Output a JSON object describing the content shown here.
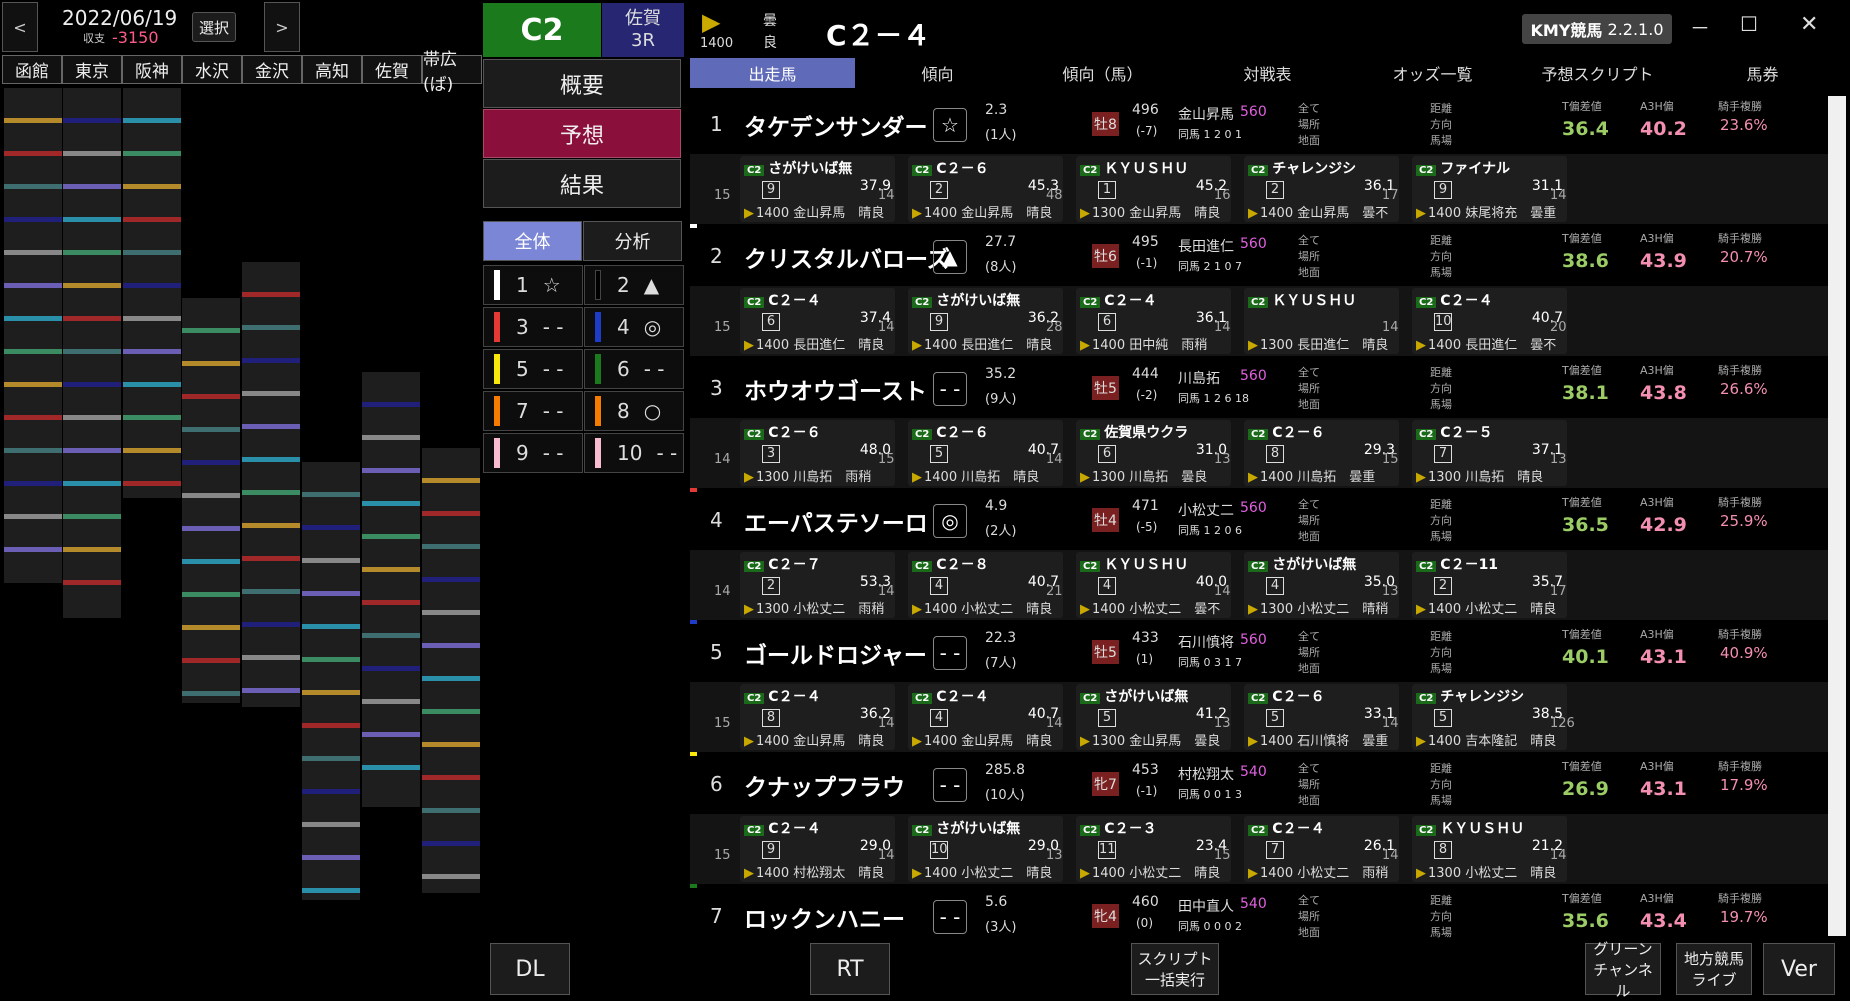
{
  "header": {
    "prev": "<",
    "next": ">",
    "date": "2022/06/19",
    "balance_label": "収支",
    "balance": "-3150",
    "select": "選択"
  },
  "venues": [
    "函館",
    "東京",
    "阪神",
    "水沢",
    "金沢",
    "高知",
    "佐賀",
    "帯広(ば)"
  ],
  "class_badge": "C2",
  "track": "佐賀",
  "race_no": "3R",
  "menu": {
    "overview": "概要",
    "predict": "予想",
    "result": "結果",
    "all": "全体",
    "analysis": "分析"
  },
  "marks": [
    {
      "no": "1",
      "mark": "☆",
      "color": "#ffffff"
    },
    {
      "no": "2",
      "mark": "▲",
      "color": "#000000"
    },
    {
      "no": "3",
      "mark": "- -",
      "color": "#e53935"
    },
    {
      "no": "4",
      "mark": "◎",
      "color": "#1e3cc8"
    },
    {
      "no": "5",
      "mark": "- -",
      "color": "#f9e80a"
    },
    {
      "no": "6",
      "mark": "- -",
      "color": "#1b7a1b"
    },
    {
      "no": "7",
      "mark": "- -",
      "color": "#f57c00"
    },
    {
      "no": "8",
      "mark": "○",
      "color": "#f57c00"
    },
    {
      "no": "9",
      "mark": "- -",
      "color": "#f8bbd0"
    },
    {
      "no": "10",
      "mark": "- -",
      "color": "#f8bbd0"
    }
  ],
  "race_header": {
    "distance": "1400",
    "weather": "曇",
    "track_state": "良",
    "title": "C２－４"
  },
  "app": {
    "name": "KMY競馬",
    "version": "2.2.1.0",
    "min": "－",
    "max": "☐",
    "close": "✕"
  },
  "tabs": [
    "出走馬",
    "傾向",
    "傾向（馬）",
    "対戦表",
    "オッズ一覧",
    "予想スクリプト",
    "馬券"
  ],
  "horses": [
    {
      "num": "1",
      "name": "タケデンサンダー",
      "mark": "☆",
      "odds": "2.3",
      "pop": "(1人)",
      "sex": "牡8",
      "weight": "496",
      "diff": "(-7)",
      "jockey": "金山昇馬",
      "jw": "560",
      "rec": "同馬 1 2 0 1",
      "t1": "36.4",
      "t2": "40.2",
      "rate": "23.6%",
      "strip": "#ffffff",
      "races": [
        {
          "t": "さがけいば無",
          "p": "9",
          "v": "37.9",
          "i": "1400 金山昇馬　晴良"
        },
        {
          "t": "C２－６",
          "p": "2",
          "v": "45.3",
          "i": "1400 金山昇馬　晴良"
        },
        {
          "t": "ＫＹＵＳＨＵ",
          "p": "1",
          "v": "45.2",
          "i": "1300 金山昇馬　晴良"
        },
        {
          "t": "チャレンジシ",
          "p": "2",
          "v": "36.1",
          "i": "1400 金山昇馬　曇不"
        },
        {
          "t": "ファイナル",
          "p": "9",
          "v": "31.1",
          "i": "1400 妹尾将充　曇重"
        }
      ],
      "sides": [
        "15",
        "14",
        "48",
        "16",
        "17",
        "14"
      ]
    },
    {
      "num": "2",
      "name": "クリスタルバローズ",
      "mark": "▲",
      "odds": "27.7",
      "pop": "(8人)",
      "sex": "牡6",
      "weight": "495",
      "diff": "(-1)",
      "jockey": "長田進仁",
      "jw": "560",
      "rec": "同馬 2 1 0 7",
      "t1": "38.6",
      "t2": "43.9",
      "rate": "20.7%",
      "strip": "#000000",
      "races": [
        {
          "t": "C２－４",
          "p": "6",
          "v": "37.4",
          "i": "1400 長田進仁　晴良"
        },
        {
          "t": "さがけいば無",
          "p": "9",
          "v": "36.2",
          "i": "1400 長田進仁　晴良"
        },
        {
          "t": "C２－４",
          "p": "6",
          "v": "36.1",
          "i": "1400 田中純　雨稍"
        },
        {
          "t": "ＫＹＵＳＨＵ",
          "p": "",
          "v": "",
          "i": "1300 長田進仁　晴良"
        },
        {
          "t": "C２－４",
          "p": "10",
          "v": "40.7",
          "i": "1400 長田進仁　曇不"
        }
      ],
      "sides": [
        "15",
        "14",
        "28",
        "14",
        "14",
        "20"
      ]
    },
    {
      "num": "3",
      "name": "ホウオウゴースト",
      "mark": "- -",
      "odds": "35.2",
      "pop": "(9人)",
      "sex": "牡5",
      "weight": "444",
      "diff": "(-2)",
      "jockey": "川島拓",
      "jw": "560",
      "rec": "同馬 1 2 6 18",
      "t1": "38.1",
      "t2": "43.8",
      "rate": "26.6%",
      "strip": "#e53935",
      "races": [
        {
          "t": "C２－６",
          "p": "3",
          "v": "48.0",
          "i": "1300 川島拓　雨稍"
        },
        {
          "t": "C２－６",
          "p": "5",
          "v": "40.7",
          "i": "1400 川島拓　晴良"
        },
        {
          "t": "佐賀県ウクラ",
          "p": "6",
          "v": "31.0",
          "i": "1300 川島拓　曇良"
        },
        {
          "t": "C２－６",
          "p": "8",
          "v": "29.3",
          "i": "1400 川島拓　曇重"
        },
        {
          "t": "C２－５",
          "p": "7",
          "v": "37.1",
          "i": "1300 川島拓　晴良"
        }
      ],
      "sides": [
        "14",
        "15",
        "14",
        "13",
        "15",
        "13"
      ]
    },
    {
      "num": "4",
      "name": "エーパステソーロ",
      "mark": "◎",
      "odds": "4.9",
      "pop": "(2人)",
      "sex": "牡4",
      "weight": "471",
      "diff": "(-5)",
      "jockey": "小松丈二",
      "jw": "560",
      "rec": "同馬 1 2 0 6",
      "t1": "36.5",
      "t2": "42.9",
      "rate": "25.9%",
      "strip": "#1e3cc8",
      "races": [
        {
          "t": "C２－７",
          "p": "2",
          "v": "53.3",
          "i": "1300 小松丈二　雨稍"
        },
        {
          "t": "C２－８",
          "p": "4",
          "v": "40.7",
          "i": "1400 小松丈二　晴良"
        },
        {
          "t": "ＫＹＵＳＨＵ",
          "p": "4",
          "v": "40.0",
          "i": "1400 小松丈二　曇不"
        },
        {
          "t": "さがけいば無",
          "p": "4",
          "v": "35.0",
          "i": "1300 小松丈二　晴稍"
        },
        {
          "t": "C２－11",
          "p": "2",
          "v": "35.7",
          "i": "1400 小松丈二　晴良"
        }
      ],
      "sides": [
        "14",
        "14",
        "21",
        "14",
        "13",
        "17"
      ]
    },
    {
      "num": "5",
      "name": "ゴールドロジャー",
      "mark": "- -",
      "odds": "22.3",
      "pop": "(7人)",
      "sex": "牡5",
      "weight": "433",
      "diff": "(1)",
      "jockey": "石川慎将",
      "jw": "560",
      "rec": "同馬 0 3 1 7",
      "t1": "40.1",
      "t2": "43.1",
      "rate": "40.9%",
      "strip": "#f9e80a",
      "races": [
        {
          "t": "C２－４",
          "p": "8",
          "v": "36.2",
          "i": "1400 金山昇馬　晴良"
        },
        {
          "t": "C２－４",
          "p": "4",
          "v": "40.7",
          "i": "1400 金山昇馬　晴良"
        },
        {
          "t": "さがけいば無",
          "p": "5",
          "v": "41.2",
          "i": "1300 金山昇馬　曇良"
        },
        {
          "t": "C２－６",
          "p": "5",
          "v": "33.1",
          "i": "1400 石川慎将　曇重"
        },
        {
          "t": "チャレンジシ",
          "p": "5",
          "v": "38.5",
          "i": "1400 吉本隆記　晴良"
        }
      ],
      "sides": [
        "15",
        "14",
        "14",
        "13",
        "14",
        "126"
      ]
    },
    {
      "num": "6",
      "name": "クナップフラウ",
      "mark": "- -",
      "odds": "285.8",
      "pop": "(10人)",
      "sex": "牝7",
      "weight": "453",
      "diff": "(-1)",
      "jockey": "村松翔太",
      "jw": "540",
      "rec": "同馬 0 0 1 3",
      "t1": "26.9",
      "t2": "43.1",
      "rate": "17.9%",
      "strip": "#1b7a1b",
      "races": [
        {
          "t": "C２－４",
          "p": "9",
          "v": "29.0",
          "i": "1400 村松翔太　晴良"
        },
        {
          "t": "さがけいば無",
          "p": "10",
          "v": "29.0",
          "i": "1400 小松丈二　晴良"
        },
        {
          "t": "C２－３",
          "p": "11",
          "v": "23.4",
          "i": "1400 小松丈二　晴良"
        },
        {
          "t": "C２－４",
          "p": "7",
          "v": "26.1",
          "i": "1400 小松丈二　雨稍"
        },
        {
          "t": "ＫＹＵＳＨＵ",
          "p": "8",
          "v": "21.2",
          "i": "1300 小松丈二　晴良"
        }
      ],
      "sides": [
        "15",
        "14",
        "13",
        "15",
        "14",
        "14"
      ]
    },
    {
      "num": "7",
      "name": "ロックンハニー",
      "mark": "- -",
      "odds": "5.6",
      "pop": "(3人)",
      "sex": "牝4",
      "weight": "460",
      "diff": "(0)",
      "jockey": "田中直人",
      "jw": "540",
      "rec": "同馬 0 0 0 2",
      "t1": "35.6",
      "t2": "43.4",
      "rate": "19.7%",
      "strip": "#1b7a1b",
      "races": [],
      "sides": []
    }
  ],
  "stat_labels": {
    "all": "全て",
    "place": "場所",
    "ground": "地面",
    "dist": "距離",
    "dir": "方向",
    "horse": "馬場",
    "t1": "T偏差値",
    "t2": "A3H偏",
    "rate": "騎手複勝"
  },
  "bottom": {
    "dl": "DL",
    "rt": "RT",
    "script": "スクリプト 一括実行",
    "green": "グリーン チャンネル",
    "local": "地方競馬 ライブ",
    "ver": "Ver"
  }
}
